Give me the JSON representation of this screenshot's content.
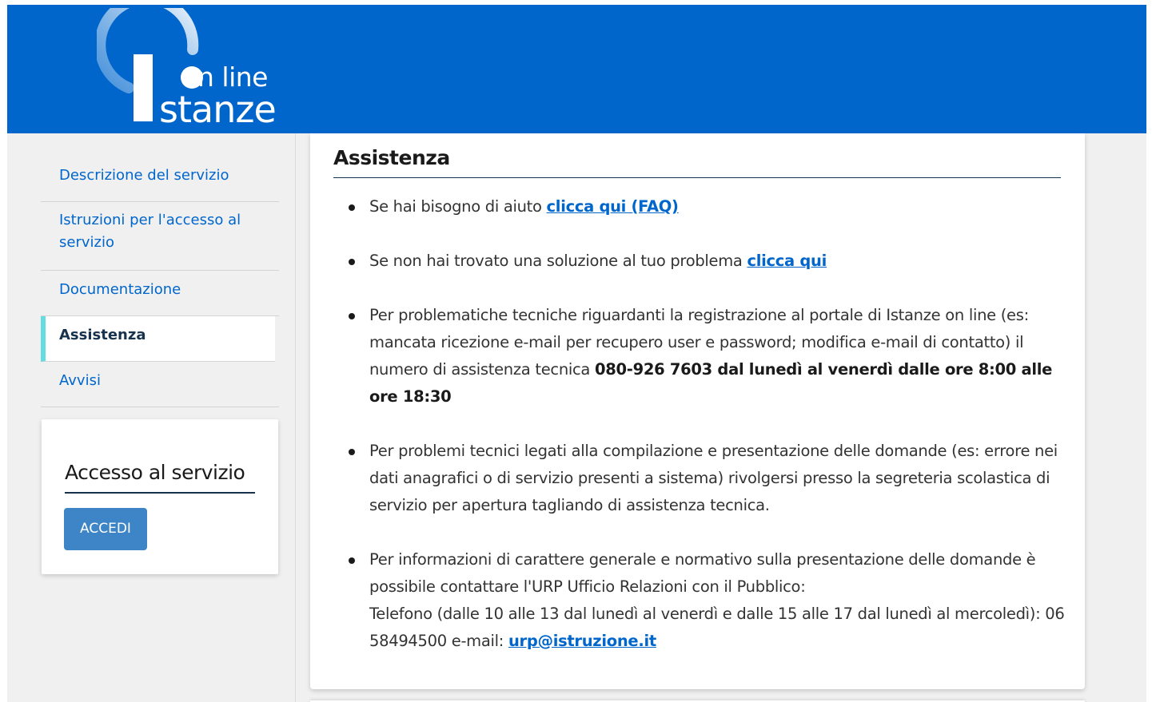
{
  "header": {
    "logo_line1": "n line",
    "logo_line2": "stanze"
  },
  "sidebar": {
    "items": [
      {
        "label": "Descrizione del servizio",
        "active": false
      },
      {
        "label": "Istruzioni per l'accesso al servizio",
        "active": false
      },
      {
        "label": "Documentazione",
        "active": false
      },
      {
        "label": "Assistenza",
        "active": true
      },
      {
        "label": "Avvisi",
        "active": false
      }
    ],
    "access_card": {
      "title": "Accesso al servizio",
      "button_label": "ACCEDI"
    }
  },
  "main": {
    "title": "Assistenza",
    "items": [
      {
        "text": "Se hai bisogno di aiuto ",
        "link": "clicca qui (FAQ)"
      },
      {
        "text": "Se non hai trovato una soluzione al tuo problema ",
        "link": "clicca qui"
      },
      {
        "text": "Per problematiche tecniche riguardanti la registrazione al portale di Istanze on line (es: mancata ricezione e-mail per recupero user e password; modifica e-mail di contatto) il numero di assistenza tecnica ",
        "bold": "080-926 7603 dal lunedì al venerdì dalle ore 8:00 alle ore 18:30"
      },
      {
        "text": "Per problemi tecnici legati alla compilazione e presentazione delle domande (es: errore nei dati anagrafici o di servizio presenti a sistema) rivolgersi presso la segreteria scolastica di servizio per apertura tagliando di assistenza tecnica."
      },
      {
        "text1": "Per informazioni di carattere generale e normativo sulla presentazione delle domande è possibile contattare l'URP Ufficio Relazioni con il Pubblico:",
        "text2": "Telefono (dalle 10 alle 13 dal lunedì al venerdì e dalle 15 alle 17 dal lunedì al mercoledì): 06 58494500 e-mail: ",
        "link": "urp@istruzione.it"
      }
    ]
  },
  "colors": {
    "header_bg": "#0066cc",
    "link": "#0066cc",
    "active_marker": "#65dcdf",
    "button_bg": "#3d85c6"
  }
}
